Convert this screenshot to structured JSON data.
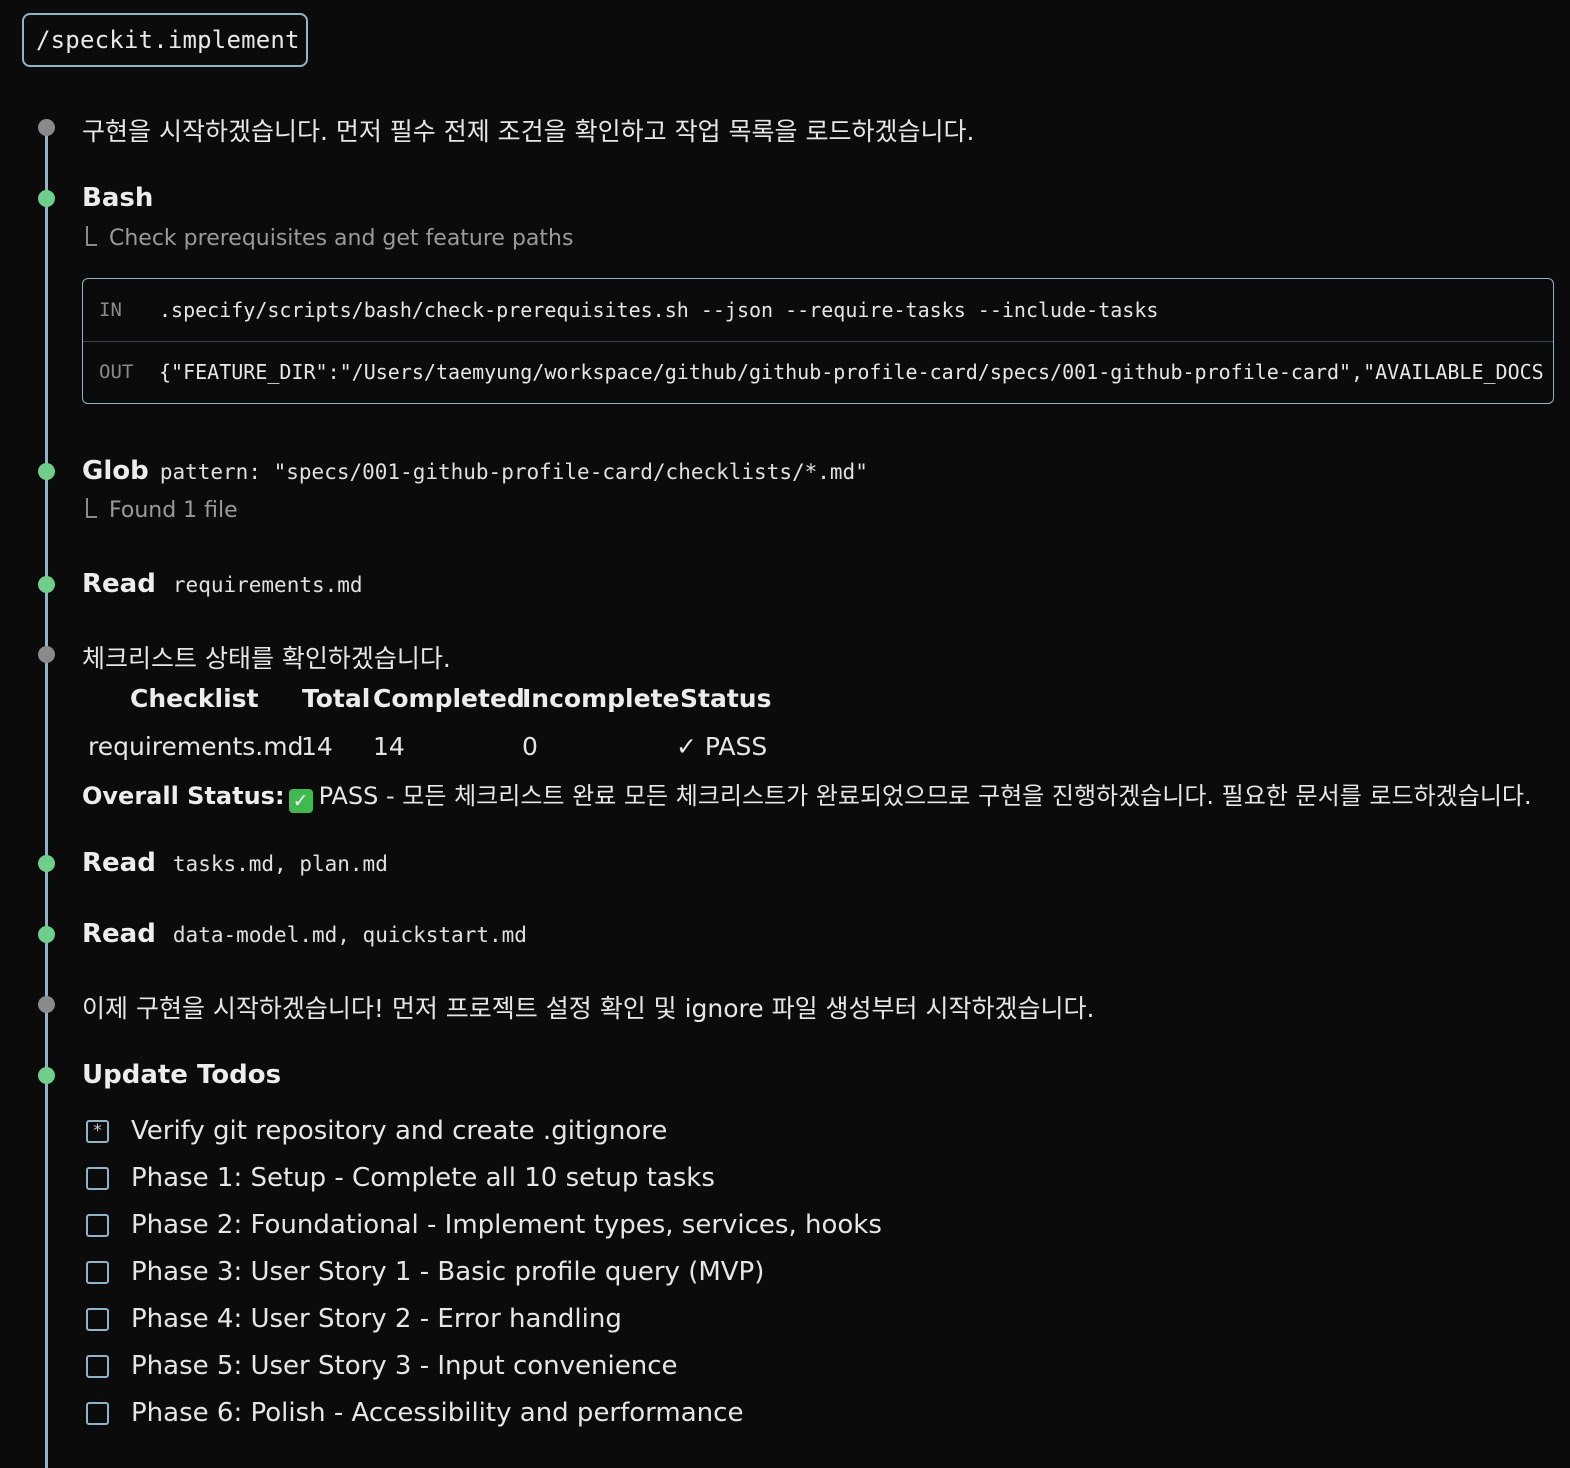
{
  "command": "/speckit.implement",
  "messages": {
    "m1": "구현을 시작하겠습니다. 먼저 필수 전제 조건을 확인하고 작업 목록을 로드하겠습니다.",
    "m2": "체크리스트 상태를 확인하겠습니다.",
    "m3": "이제 구현을 시작하겠습니다! 먼저 프로젝트 설정 확인 및 ignore 파일 생성부터 시작하겠습니다."
  },
  "bash": {
    "title": "Bash",
    "subtitle": "Check prerequisites and get feature paths",
    "in_label": "IN",
    "in_text": ".specify/scripts/bash/check-prerequisites.sh --json --require-tasks --include-tasks",
    "out_label": "OUT",
    "out_text": "{\"FEATURE_DIR\":\"/Users/taemyung/workspace/github/github-profile-card/specs/001-github-profile-card\",\"AVAILABLE_DOCS"
  },
  "glob": {
    "title": "Glob",
    "arg": "pattern: \"specs/001-github-profile-card/checklists/*.md\"",
    "result": "Found 1 file"
  },
  "reads": [
    {
      "title": "Read",
      "files": "requirements.md"
    },
    {
      "title": "Read",
      "files": "tasks.md, plan.md"
    },
    {
      "title": "Read",
      "files": "data-model.md, quickstart.md"
    }
  ],
  "checklist_table": {
    "headers": [
      "Checklist",
      "Total",
      "Completed",
      "Incomplete",
      "Status"
    ],
    "row": [
      "requirements.md",
      "14",
      "14",
      "0",
      "✓ PASS"
    ]
  },
  "overall": {
    "label": "Overall Status:",
    "icon": "✓",
    "text": "PASS - 모든 체크리스트 완료 모든 체크리스트가 완료되었으므로 구현을 진행하겠습니다. 필요한 문서를 로드하겠습니다."
  },
  "todos": {
    "title": "Update Todos",
    "items": [
      {
        "label": "Verify git repository and create .gitignore",
        "state": "in_progress",
        "mark": "*"
      },
      {
        "label": "Phase 1: Setup - Complete all 10 setup tasks",
        "state": "pending",
        "mark": ""
      },
      {
        "label": "Phase 2: Foundational - Implement types, services, hooks",
        "state": "pending",
        "mark": ""
      },
      {
        "label": "Phase 3: User Story 1 - Basic profile query (MVP)",
        "state": "pending",
        "mark": ""
      },
      {
        "label": "Phase 4: User Story 2 - Error handling",
        "state": "pending",
        "mark": ""
      },
      {
        "label": "Phase 5: User Story 3 - Input convenience",
        "state": "pending",
        "mark": ""
      },
      {
        "label": "Phase 6: Polish - Accessibility and performance",
        "state": "pending",
        "mark": ""
      }
    ]
  },
  "colors": {
    "background": "#0b0b0c",
    "accent_border": "#8fb3c9",
    "dot_green": "#6fcf8a",
    "dot_grey": "#8a8a8a",
    "check_green": "#3fb950"
  }
}
